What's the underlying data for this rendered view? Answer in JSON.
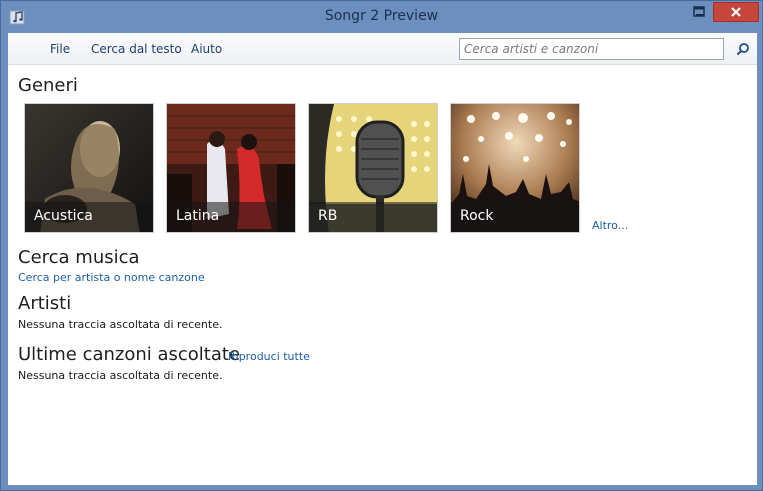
{
  "window": {
    "title": "Songr 2 Preview"
  },
  "menu": {
    "items": [
      "File",
      "Cerca dal testo",
      "Aiuto"
    ]
  },
  "search": {
    "placeholder": "Cerca artisti e canzoni",
    "value": ""
  },
  "genres": {
    "heading": "Generi",
    "tiles": [
      {
        "label": "Acustica"
      },
      {
        "label": "Latina"
      },
      {
        "label": "RB"
      },
      {
        "label": "Rock"
      }
    ],
    "more_link": "Altro..."
  },
  "search_music": {
    "heading": "Cerca musica",
    "link": "Cerca per artista o nome canzone"
  },
  "artists": {
    "heading": "Artisti",
    "empty_text": "Nessuna traccia ascoltata di recente."
  },
  "recent": {
    "heading": "Ultime canzoni ascoltate",
    "play_all": "Riproduci tutte",
    "empty_text": "Nessuna traccia ascoltata di recente."
  },
  "colors": {
    "titlebar": "#6c8fbf",
    "close_button": "#c7463b",
    "link": "#1c5ea5"
  },
  "icons": {
    "app": "music-note-icon",
    "minimize": "minimize-icon",
    "maximize": "maximize-icon",
    "close": "close-icon",
    "search": "search-icon"
  }
}
